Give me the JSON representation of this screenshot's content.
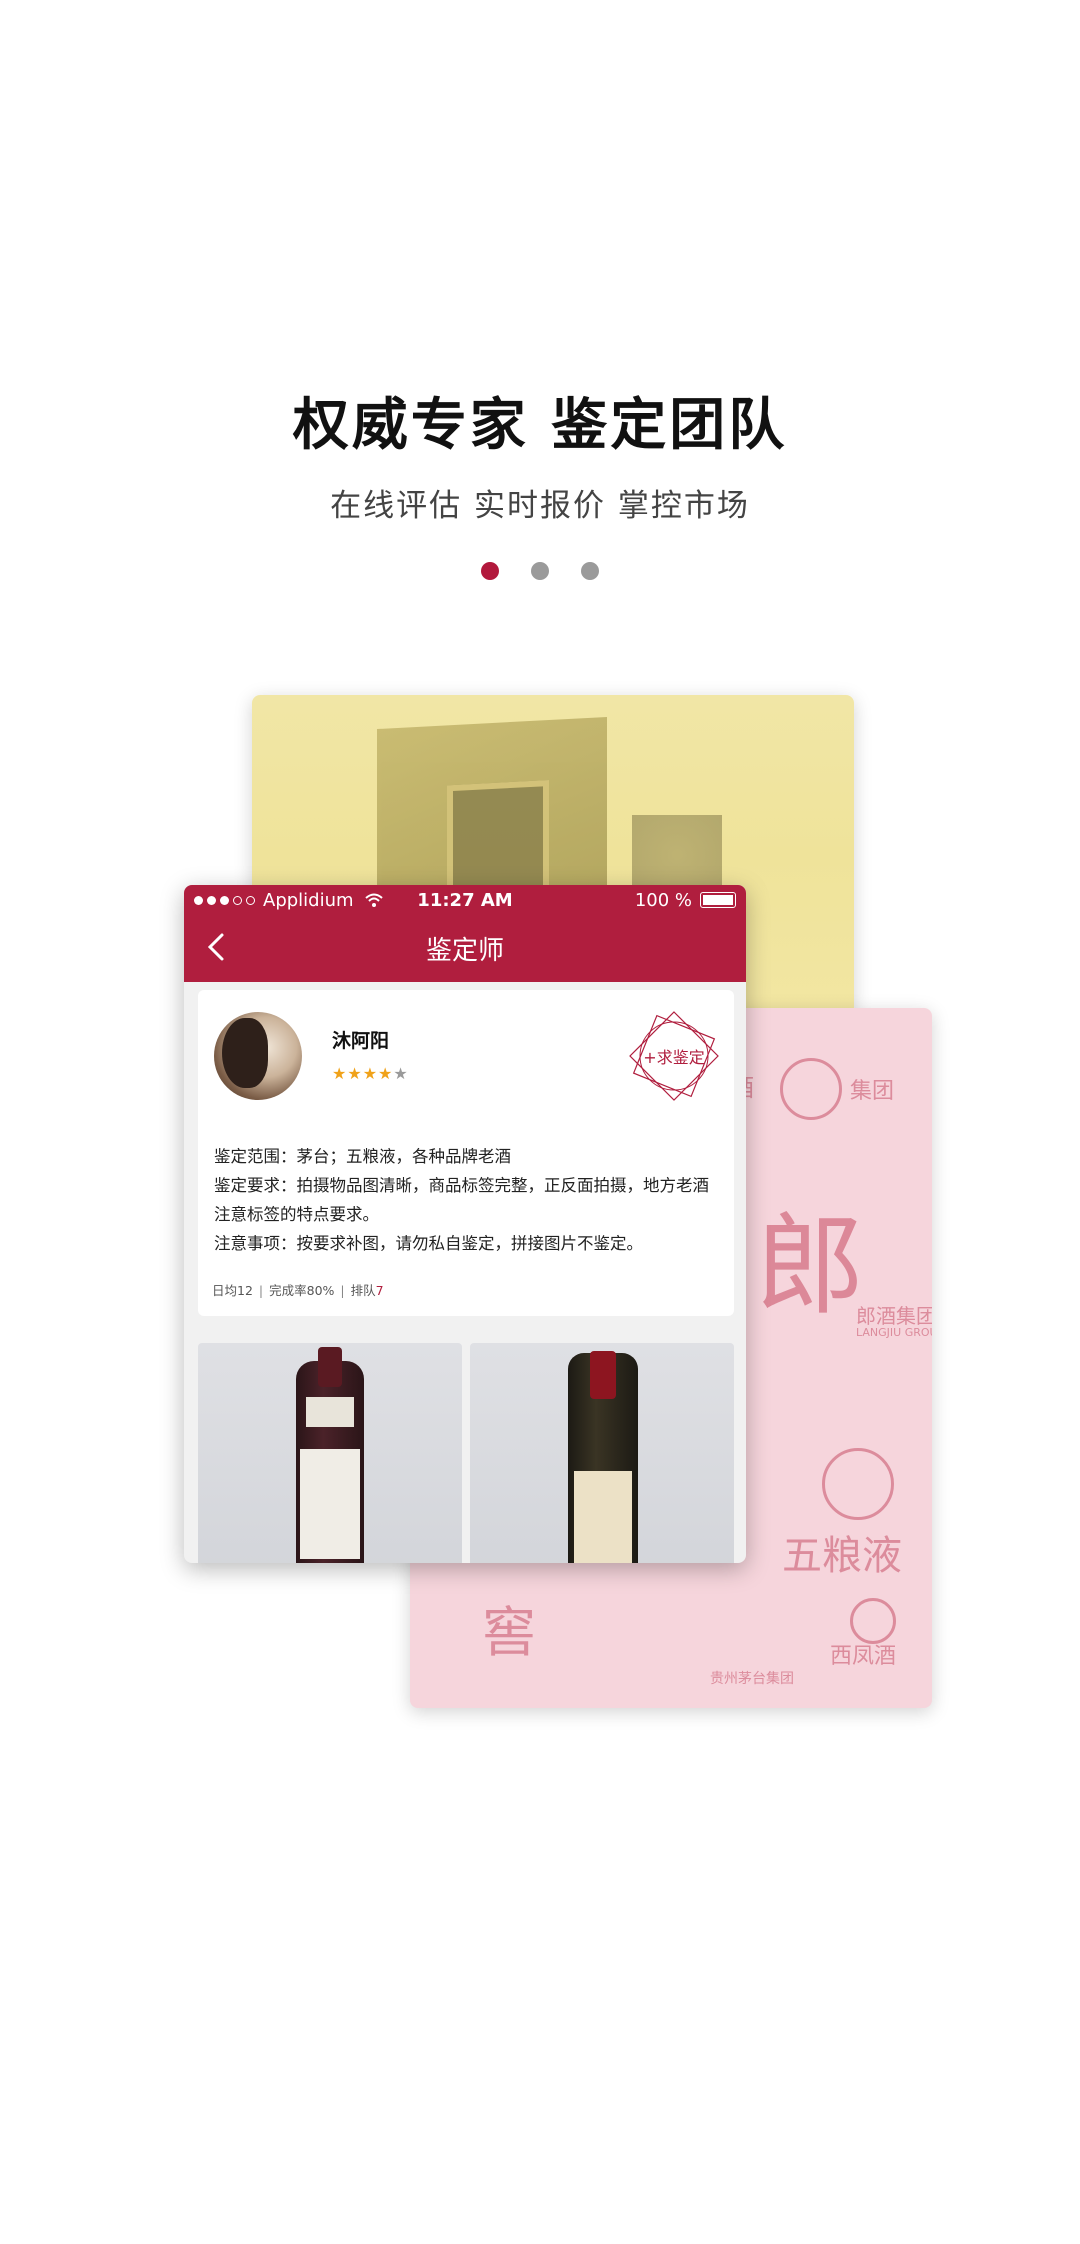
{
  "hero": {
    "title": "权威专家 鉴定团队",
    "subtitle": "在线评估 实时报价 掌控市场",
    "pager": {
      "count": 3,
      "active": 0
    }
  },
  "phone": {
    "status": {
      "carrier": "Applidium",
      "time": "11:27 AM",
      "battery": "100 %"
    },
    "nav_title": "鉴定师",
    "appraiser": {
      "name": "沐阿阳",
      "rating": 4,
      "rating_max": 5,
      "ask_button": "+求鉴定",
      "scope": "鉴定范围：茅台；五粮液，各种品牌老酒",
      "requirements": "鉴定要求：拍摄物品图清晰，商品标签完整，正反面拍摄，地方老酒注意标签的特点要求。",
      "notes": "注意事项：按要求补图，请勿私自鉴定，拼接图片不鉴定。",
      "stats": {
        "daily": "日均12",
        "completion": "完成率80%",
        "queue_label": "排队",
        "queue_value": "7"
      }
    },
    "photos": [
      "wine-photo-1",
      "wine-photo-2"
    ]
  },
  "background": {
    "pink_card": {
      "logo_text_1": "酒",
      "logo_text_2": "集团",
      "big_char": "郎",
      "brand_1": "郎酒集团",
      "brand_1_en": "LANGJIU GROUP",
      "brand_2": "五粮液",
      "brand_3": "窖",
      "brand_4": "西凤酒",
      "brand_5": "贵州茅台集团"
    }
  },
  "colors": {
    "accent": "#b01e3e",
    "star": "#f0a21a"
  }
}
